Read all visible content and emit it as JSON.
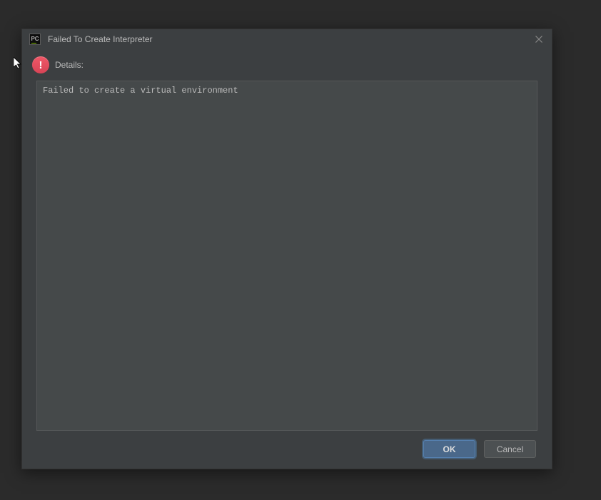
{
  "dialog": {
    "title": "Failed To Create Interpreter",
    "details_label": "Details:",
    "message": "Failed to create a virtual environment",
    "buttons": {
      "ok": "OK",
      "cancel": "Cancel"
    },
    "app_icon_text": "PC"
  }
}
